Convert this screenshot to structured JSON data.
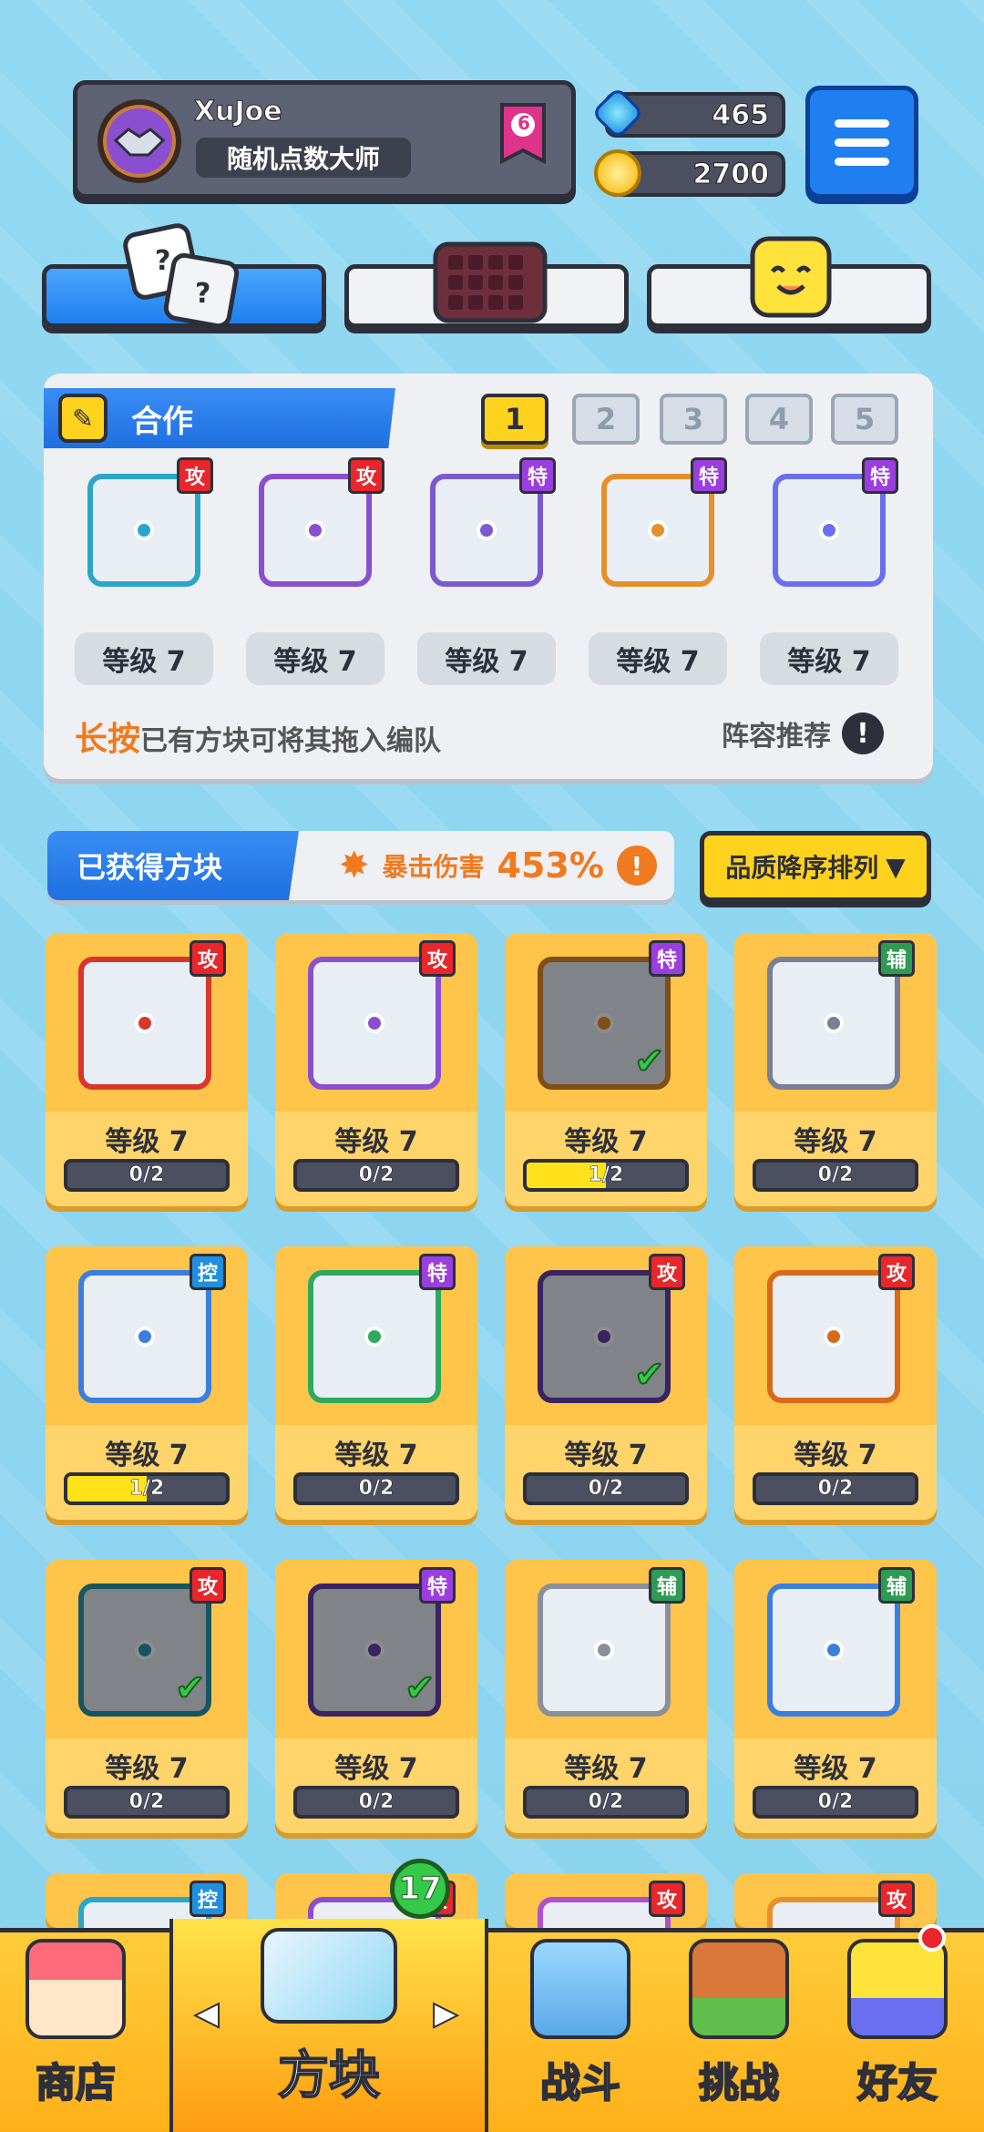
{
  "header": {
    "player_name": "XuJoe",
    "player_title": "随机点数大师",
    "rank": "6",
    "gems": "465",
    "coins": "2700"
  },
  "tabs": [
    {
      "name": "dice"
    },
    {
      "name": "board"
    },
    {
      "name": "emote"
    }
  ],
  "team": {
    "label": "合作",
    "slots": [
      "1",
      "2",
      "3",
      "4",
      "5"
    ],
    "active_slot": "1",
    "cards": [
      {
        "tag": "攻",
        "level": "等级 7",
        "color": "#2aa6c9",
        "tagcolor": "#e8262b"
      },
      {
        "tag": "攻",
        "level": "等级 7",
        "color": "#8a4fd1",
        "tagcolor": "#e8262b"
      },
      {
        "tag": "特",
        "level": "等级 7",
        "color": "#7a5ad0",
        "tagcolor": "#9a3ee0"
      },
      {
        "tag": "特",
        "level": "等级 7",
        "color": "#e6902a",
        "tagcolor": "#9a3ee0"
      },
      {
        "tag": "特",
        "level": "等级 7",
        "color": "#6a6ff0",
        "tagcolor": "#9a3ee0"
      }
    ],
    "hint_em": "长按",
    "hint": "已有方块可将其拖入编队",
    "recommend": "阵容推荐"
  },
  "owned": {
    "label": "已获得方块",
    "crit_label": "暴击伤害",
    "crit_value": "453%",
    "sort_label": "品质降序排列",
    "items": [
      {
        "tag": "攻",
        "tagcolor": "#e8262b",
        "color": "#d9362b",
        "level": "等级 7",
        "progress": "0/2",
        "fill": 0,
        "dim": false,
        "check": false
      },
      {
        "tag": "攻",
        "tagcolor": "#e8262b",
        "color": "#8a4fd1",
        "level": "等级 7",
        "progress": "0/2",
        "fill": 0,
        "dim": false,
        "check": false
      },
      {
        "tag": "特",
        "tagcolor": "#9a3ee0",
        "color": "#e6902a",
        "level": "等级 7",
        "progress": "1/2",
        "fill": 0.5,
        "dim": true,
        "check": true
      },
      {
        "tag": "辅",
        "tagcolor": "#2e9b54",
        "color": "#7a7f95",
        "level": "等级 7",
        "progress": "0/2",
        "fill": 0,
        "dim": false,
        "check": false
      },
      {
        "tag": "控",
        "tagcolor": "#1f8fe0",
        "color": "#3a7fe0",
        "level": "等级 7",
        "progress": "1/2",
        "fill": 0.5,
        "dim": false,
        "check": false
      },
      {
        "tag": "特",
        "tagcolor": "#9a3ee0",
        "color": "#2fa860",
        "level": "等级 7",
        "progress": "0/2",
        "fill": 0,
        "dim": false,
        "check": false
      },
      {
        "tag": "攻",
        "tagcolor": "#e8262b",
        "color": "#6a3fb0",
        "level": "等级 7",
        "progress": "0/2",
        "fill": 0,
        "dim": true,
        "check": true
      },
      {
        "tag": "攻",
        "tagcolor": "#e8262b",
        "color": "#d96a1a",
        "level": "等级 7",
        "progress": "0/2",
        "fill": 0,
        "dim": false,
        "check": false
      },
      {
        "tag": "攻",
        "tagcolor": "#e8262b",
        "color": "#2a9bb0",
        "level": "等级 7",
        "progress": "0/2",
        "fill": 0,
        "dim": true,
        "check": true
      },
      {
        "tag": "特",
        "tagcolor": "#9a3ee0",
        "color": "#6a3fb0",
        "level": "等级 7",
        "progress": "0/2",
        "fill": 0,
        "dim": true,
        "check": true
      },
      {
        "tag": "辅",
        "tagcolor": "#2e9b54",
        "color": "#8a8f9a",
        "level": "等级 7",
        "progress": "0/2",
        "fill": 0,
        "dim": false,
        "check": false
      },
      {
        "tag": "辅",
        "tagcolor": "#2e9b54",
        "color": "#3a7fe0",
        "level": "等级 7",
        "progress": "0/2",
        "fill": 0,
        "dim": false,
        "check": false
      },
      {
        "tag": "控",
        "tagcolor": "#1f8fe0",
        "color": "#2aa6c9",
        "level": "",
        "progress": "",
        "fill": 0,
        "dim": false,
        "check": false
      },
      {
        "tag": "攻",
        "tagcolor": "#e8262b",
        "color": "#8a4fd1",
        "level": "",
        "progress": "",
        "fill": 0,
        "dim": false,
        "check": false
      },
      {
        "tag": "攻",
        "tagcolor": "#e8262b",
        "color": "#b04fd1",
        "level": "",
        "progress": "",
        "fill": 0,
        "dim": false,
        "check": false
      },
      {
        "tag": "攻",
        "tagcolor": "#e8262b",
        "color": "#e6902a",
        "level": "",
        "progress": "",
        "fill": 0,
        "dim": false,
        "check": false
      }
    ]
  },
  "nav": {
    "shop": "商店",
    "blocks": "方块",
    "battle": "战斗",
    "challenge": "挑战",
    "friends": "好友",
    "blocks_badge": "17"
  }
}
